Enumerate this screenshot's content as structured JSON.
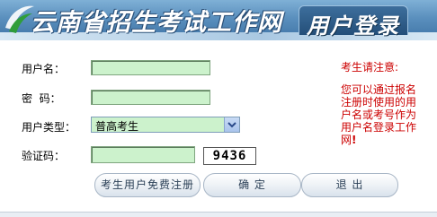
{
  "header": {
    "site_title": "云南省招生考试工作网",
    "section_title": "用户登录"
  },
  "form": {
    "username_label": "用户名：",
    "password_label": "密  码：",
    "usertype_label": "用户类型：",
    "usertype_value": "普高考生",
    "captcha_label": "验证码：",
    "captcha_code": "9436"
  },
  "notice": {
    "title": "考生请注意:",
    "body": "您可以通过报名注册时使用的用户名或考号作为用户名登录工作网",
    "mark": "!"
  },
  "buttons": {
    "register": "考生用户免费注册",
    "confirm": "确  定",
    "exit": "退  出"
  },
  "colors": {
    "field_bg": "#ccf2cc",
    "notice_text": "#cc0000",
    "banner_blue": "#4f85b5"
  }
}
